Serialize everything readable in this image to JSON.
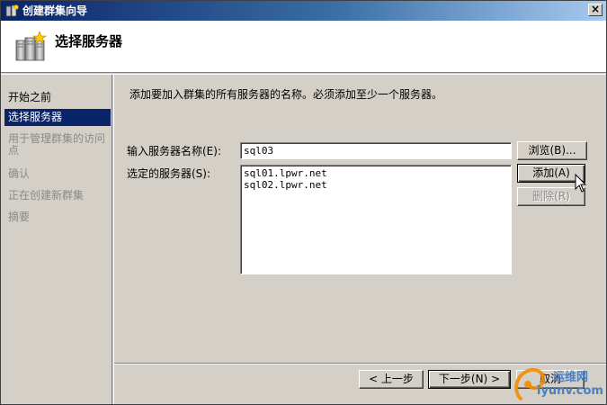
{
  "window": {
    "title": "创建群集向导",
    "close_label": "×"
  },
  "header": {
    "title": "选择服务器"
  },
  "nav": {
    "items": [
      {
        "label": "开始之前",
        "state": "normal"
      },
      {
        "label": "选择服务器",
        "state": "active"
      },
      {
        "label": "用于管理群集的访问点",
        "state": "disabled"
      },
      {
        "label": "确认",
        "state": "disabled"
      },
      {
        "label": "正在创建新群集",
        "state": "disabled"
      },
      {
        "label": "摘要",
        "state": "disabled"
      }
    ]
  },
  "main": {
    "description": "添加要加入群集的所有服务器的名称。必须添加至少一个服务器。",
    "server_name_label": "输入服务器名称(E):",
    "server_name_value": "sql03",
    "selected_label": "选定的服务器(S):",
    "selected_servers": [
      "sql01.lpwr.net",
      "sql02.lpwr.net"
    ],
    "browse_button": "浏览(B)...",
    "add_button": "添加(A)",
    "remove_button": "删除(R)"
  },
  "footer": {
    "prev_button": "< 上一步",
    "next_button": "下一步(N) >",
    "cancel_button": "取消"
  },
  "watermark": {
    "line1": "运维网",
    "line2": "iyunv.com"
  },
  "colors": {
    "title_gradient_start": "#0a246a",
    "selection": "#0a246a",
    "dialog_face": "#d4d0c8",
    "disabled_text": "#8a8a8a"
  }
}
